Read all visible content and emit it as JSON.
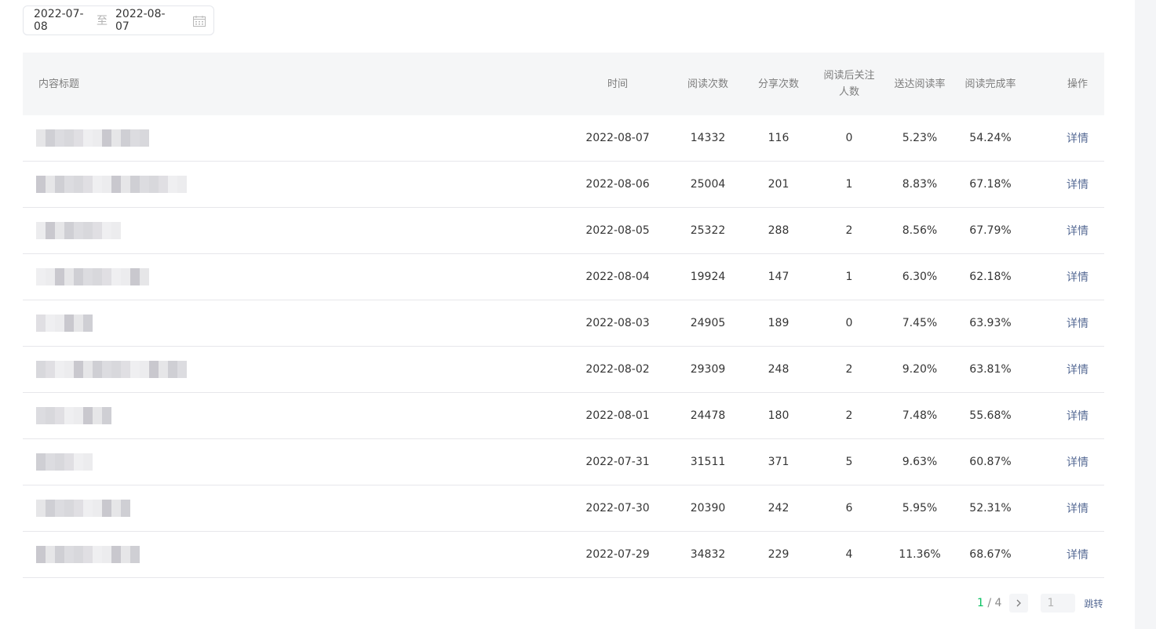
{
  "date_range": {
    "start": "2022-07-08",
    "separator": "至",
    "end": "2022-08-07"
  },
  "table": {
    "headers": {
      "title": "内容标题",
      "time": "时间",
      "reads": "阅读次数",
      "shares": "分享次数",
      "follows_line1": "阅读后关注",
      "follows_line2": "人数",
      "reach_rate": "送达阅读率",
      "finish_rate": "阅读完成率",
      "action": "操作"
    },
    "rows": [
      {
        "time": "2022-08-07",
        "reads": "14332",
        "shares": "116",
        "follows": "0",
        "reach_rate": "5.23%",
        "finish_rate": "54.24%",
        "action": "详情"
      },
      {
        "time": "2022-08-06",
        "reads": "25004",
        "shares": "201",
        "follows": "1",
        "reach_rate": "8.83%",
        "finish_rate": "67.18%",
        "action": "详情"
      },
      {
        "time": "2022-08-05",
        "reads": "25322",
        "shares": "288",
        "follows": "2",
        "reach_rate": "8.56%",
        "finish_rate": "67.79%",
        "action": "详情"
      },
      {
        "time": "2022-08-04",
        "reads": "19924",
        "shares": "147",
        "follows": "1",
        "reach_rate": "6.30%",
        "finish_rate": "62.18%",
        "action": "详情"
      },
      {
        "time": "2022-08-03",
        "reads": "24905",
        "shares": "189",
        "follows": "0",
        "reach_rate": "7.45%",
        "finish_rate": "63.93%",
        "action": "详情"
      },
      {
        "time": "2022-08-02",
        "reads": "29309",
        "shares": "248",
        "follows": "2",
        "reach_rate": "9.20%",
        "finish_rate": "63.81%",
        "action": "详情"
      },
      {
        "time": "2022-08-01",
        "reads": "24478",
        "shares": "180",
        "follows": "2",
        "reach_rate": "7.48%",
        "finish_rate": "55.68%",
        "action": "详情"
      },
      {
        "time": "2022-07-31",
        "reads": "31511",
        "shares": "371",
        "follows": "5",
        "reach_rate": "9.63%",
        "finish_rate": "60.87%",
        "action": "详情"
      },
      {
        "time": "2022-07-30",
        "reads": "20390",
        "shares": "242",
        "follows": "6",
        "reach_rate": "5.95%",
        "finish_rate": "52.31%",
        "action": "详情"
      },
      {
        "time": "2022-07-29",
        "reads": "34832",
        "shares": "229",
        "follows": "4",
        "reach_rate": "11.36%",
        "finish_rate": "68.67%",
        "action": "详情"
      }
    ]
  },
  "pagination": {
    "current": "1",
    "divider": " / ",
    "total": "4",
    "jump_value": "1",
    "jump_label": "跳转"
  },
  "icons": {
    "calendar": "calendar-icon",
    "next": "chevron-right-icon"
  }
}
